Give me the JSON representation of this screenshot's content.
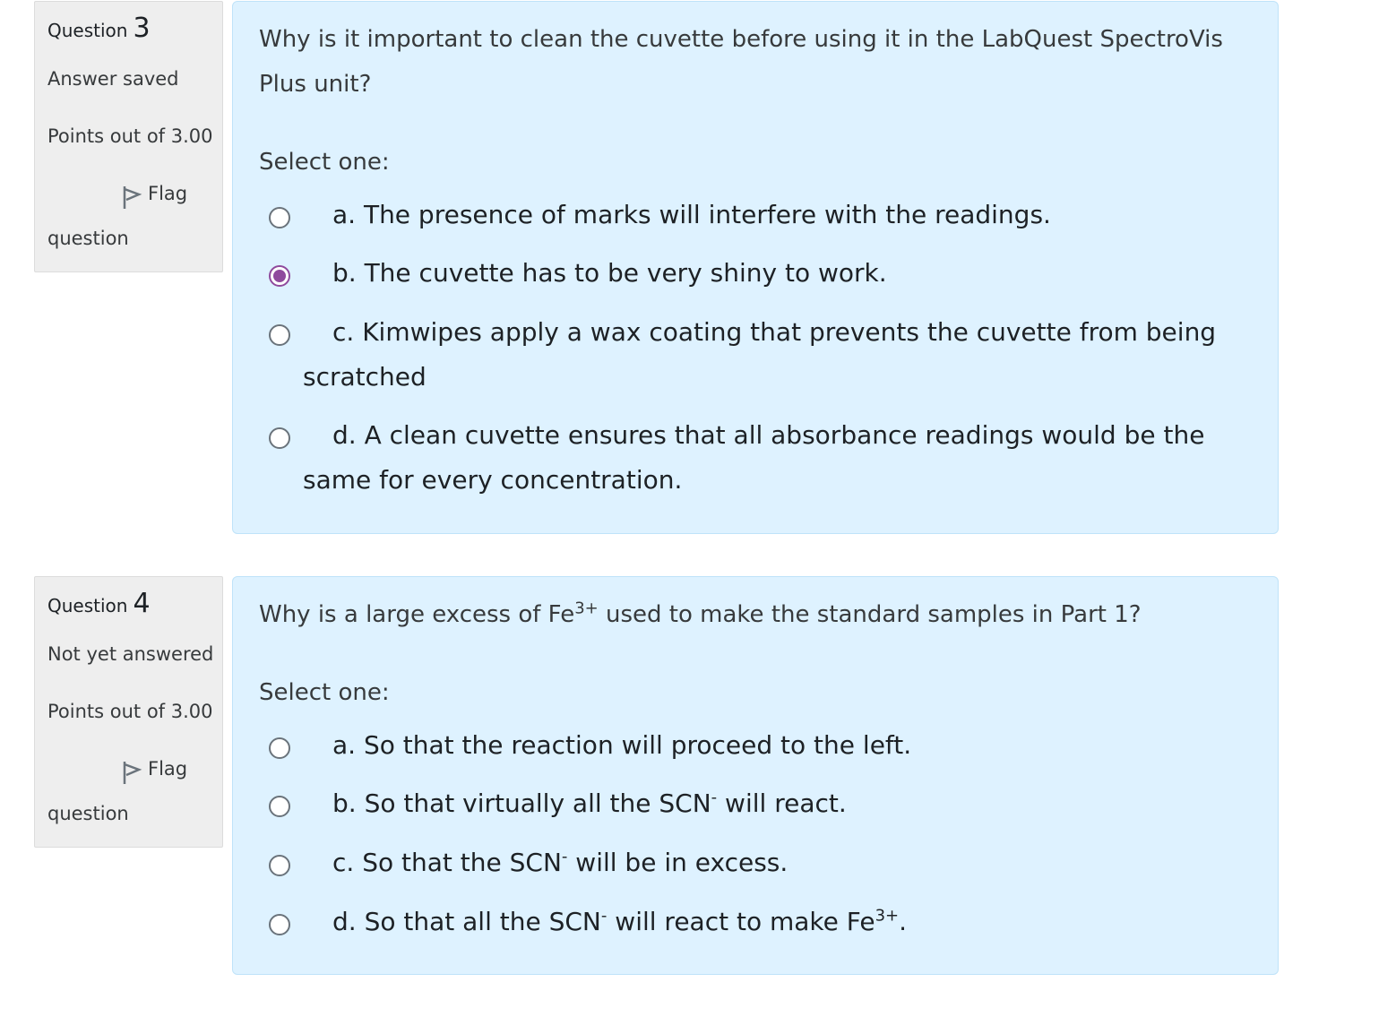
{
  "questions": [
    {
      "label": "Question",
      "number": "3",
      "state": "Answer saved",
      "grade": "Points out of 3.00",
      "flag_label": "Flag",
      "flag_label_2": "question",
      "text": "Why is it important to clean the cuvette before using it in the LabQuest SpectroVis Plus unit?",
      "prompt": "Select one:",
      "options": [
        {
          "text": "a. The presence of marks will interfere with the readings.",
          "selected": false
        },
        {
          "text": "b. The cuvette has to be very shiny to work.",
          "selected": true
        },
        {
          "text": "c. Kimwipes apply a wax coating that prevents the cuvette from being scratched",
          "selected": false
        },
        {
          "text": "d. A clean cuvette ensures that all absorbance readings would be the same for every concentration.",
          "selected": false
        }
      ]
    },
    {
      "label": "Question",
      "number": "4",
      "state": "Not yet answered",
      "grade": "Points out of 3.00",
      "flag_label": "Flag",
      "flag_label_2": "question",
      "text_before": "Why is a large excess of Fe",
      "text_sup": "3+",
      "text_after": " used to make the standard samples in Part 1?",
      "prompt": "Select one:",
      "options": [
        {
          "pre": "a. So that the reaction will proceed to the left.",
          "sup": "",
          "post": "",
          "selected": false
        },
        {
          "pre": "b. So that virtually all the SCN",
          "sup": "-",
          "post": " will react.",
          "selected": false
        },
        {
          "pre": "c. So that the SCN",
          "sup": "-",
          "post": " will be in excess.",
          "selected": false
        },
        {
          "pre": "d. So that all the SCN",
          "sup": "-",
          "post": " will react to make Fe",
          "sup2": "3+",
          "post2": ".",
          "selected": false
        }
      ]
    }
  ],
  "colors": {
    "accent": "#8f4a9d",
    "panel": "#def2ff",
    "info": "#eeeeee"
  },
  "icons": {
    "flag": "flag-icon"
  }
}
